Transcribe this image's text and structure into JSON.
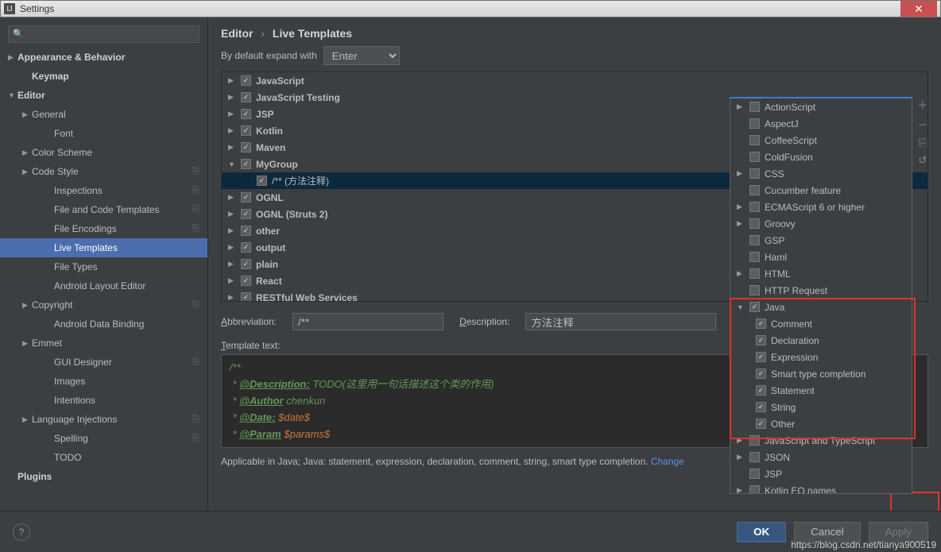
{
  "window": {
    "title": "Settings"
  },
  "search": {
    "placeholder": "Q"
  },
  "sidebar": [
    {
      "lbl": "Appearance & Behavior",
      "lvl": 0,
      "arrow": "▶",
      "bold": true
    },
    {
      "lbl": "Keymap",
      "lvl": 1,
      "bold": true
    },
    {
      "lbl": "Editor",
      "lvl": 0,
      "arrow": "▼",
      "bold": true
    },
    {
      "lbl": "General",
      "lvl": 1,
      "arrow": "▶"
    },
    {
      "lbl": "Font",
      "lvl": 2
    },
    {
      "lbl": "Color Scheme",
      "lvl": 1,
      "arrow": "▶"
    },
    {
      "lbl": "Code Style",
      "lvl": 1,
      "arrow": "▶",
      "copy": true
    },
    {
      "lbl": "Inspections",
      "lvl": 2,
      "copy": true
    },
    {
      "lbl": "File and Code Templates",
      "lvl": 2,
      "copy": true
    },
    {
      "lbl": "File Encodings",
      "lvl": 2,
      "copy": true
    },
    {
      "lbl": "Live Templates",
      "lvl": 2,
      "copy": true,
      "sel": true
    },
    {
      "lbl": "File Types",
      "lvl": 2
    },
    {
      "lbl": "Android Layout Editor",
      "lvl": 2
    },
    {
      "lbl": "Copyright",
      "lvl": 1,
      "arrow": "▶",
      "copy": true
    },
    {
      "lbl": "Android Data Binding",
      "lvl": 2
    },
    {
      "lbl": "Emmet",
      "lvl": 1,
      "arrow": "▶"
    },
    {
      "lbl": "GUI Designer",
      "lvl": 2,
      "copy": true
    },
    {
      "lbl": "Images",
      "lvl": 2
    },
    {
      "lbl": "Intentions",
      "lvl": 2
    },
    {
      "lbl": "Language Injections",
      "lvl": 1,
      "arrow": "▶",
      "copy": true
    },
    {
      "lbl": "Spelling",
      "lvl": 2,
      "copy": true
    },
    {
      "lbl": "TODO",
      "lvl": 2
    },
    {
      "lbl": "Plugins",
      "lvl": 0,
      "bold": true
    }
  ],
  "breadcrumb": {
    "a": "Editor",
    "b": "Live Templates"
  },
  "expand": {
    "label": "By default expand with",
    "value": "Enter"
  },
  "groups": [
    {
      "lbl": "JavaScript",
      "ck": true,
      "arrow": "▶"
    },
    {
      "lbl": "JavaScript Testing",
      "ck": true,
      "arrow": "▶"
    },
    {
      "lbl": "JSP",
      "ck": true,
      "arrow": "▶"
    },
    {
      "lbl": "Kotlin",
      "ck": true,
      "arrow": "▶"
    },
    {
      "lbl": "Maven",
      "ck": true,
      "arrow": "▶"
    },
    {
      "lbl": "MyGroup",
      "ck": true,
      "arrow": "▼",
      "children": [
        {
          "lbl": "/** (方法注释)",
          "ck": true,
          "sel": true
        }
      ]
    },
    {
      "lbl": "OGNL",
      "ck": true,
      "arrow": "▶"
    },
    {
      "lbl": "OGNL (Struts 2)",
      "ck": true,
      "arrow": "▶"
    },
    {
      "lbl": "other",
      "ck": true,
      "arrow": "▶"
    },
    {
      "lbl": "output",
      "ck": true,
      "arrow": "▶"
    },
    {
      "lbl": "plain",
      "ck": true,
      "arrow": "▶"
    },
    {
      "lbl": "React",
      "ck": true,
      "arrow": "▶"
    },
    {
      "lbl": "RESTful Web Services",
      "ck": true,
      "arrow": "▶"
    }
  ],
  "form": {
    "abbrLabel": "Abbreviation:",
    "abbr": "/**",
    "descLabel": "Description:",
    "desc": "方法注释",
    "tmplLabel": "Template text:"
  },
  "code": {
    "l1a": "/**",
    "l2a": " * ",
    "l2b": "@Description:",
    "l2c": " TODO(这里用一句话描述这个类的作用)",
    "l3a": " * ",
    "l3b": "@Author",
    "l3c": " chenkun",
    "l4a": " * ",
    "l4b": "@Date:",
    "l4c": " ",
    "l4v": "$date$",
    "l5a": " * ",
    "l5b": "@Param",
    "l5c": " ",
    "l5v": "$params$"
  },
  "applicable": {
    "text": "Applicable in Java; Java: statement, expression, declaration, comment, string, smart type completion.",
    "link": "Change"
  },
  "popup": [
    {
      "lbl": "ActionScript",
      "arrow": "▶"
    },
    {
      "lbl": "AspectJ"
    },
    {
      "lbl": "CoffeeScript"
    },
    {
      "lbl": "ColdFusion"
    },
    {
      "lbl": "CSS",
      "arrow": "▶"
    },
    {
      "lbl": "Cucumber feature"
    },
    {
      "lbl": "ECMAScript 6 or higher",
      "arrow": "▶"
    },
    {
      "lbl": "Groovy",
      "arrow": "▶"
    },
    {
      "lbl": "GSP"
    },
    {
      "lbl": "Haml"
    },
    {
      "lbl": "HTML",
      "arrow": "▶"
    },
    {
      "lbl": "HTTP Request"
    },
    {
      "lbl": "Java",
      "arrow": "▼",
      "ck": true,
      "children": [
        {
          "lbl": "Comment",
          "ck": true
        },
        {
          "lbl": "Declaration",
          "ck": true
        },
        {
          "lbl": "Expression",
          "ck": true
        },
        {
          "lbl": "Smart type completion",
          "ck": true
        },
        {
          "lbl": "Statement",
          "ck": true
        },
        {
          "lbl": "String",
          "ck": true
        },
        {
          "lbl": "Other",
          "ck": true
        }
      ]
    },
    {
      "lbl": "JavaScript and TypeScript",
      "arrow": "▶"
    },
    {
      "lbl": "JSON",
      "arrow": "▶"
    },
    {
      "lbl": "JSP"
    },
    {
      "lbl": "Kotlin EQ names",
      "arrow": "▶"
    }
  ],
  "buttons": {
    "ok": "OK",
    "cancel": "Cancel",
    "apply": "Apply"
  },
  "watermark": "https://blog.csdn.net/tianya900519"
}
